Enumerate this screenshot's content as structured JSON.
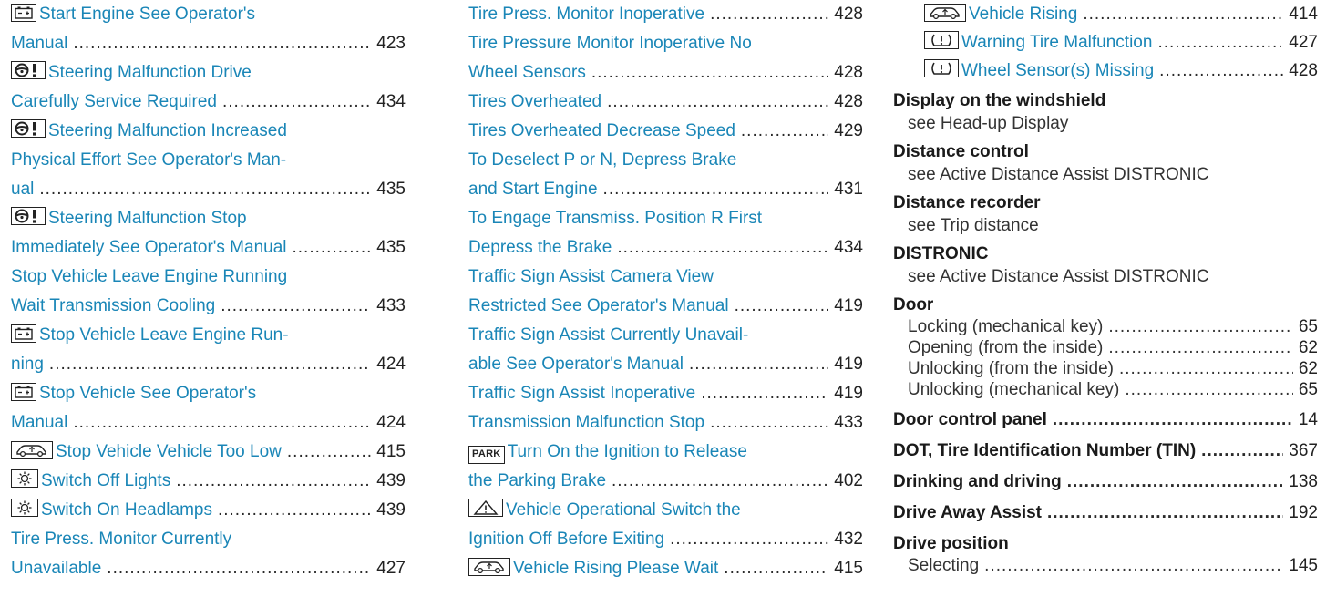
{
  "col1": [
    {
      "icon": "battery",
      "lines": [
        "Start Engine See Operator's",
        "Manual"
      ],
      "page": "423"
    },
    {
      "icon": "steering-warning",
      "lines": [
        "Steering Malfunction Drive",
        "Carefully Service Required"
      ],
      "page": "434"
    },
    {
      "icon": "steering-warning",
      "lines": [
        "Steering Malfunction Increased",
        "Physical Effort See Operator's Man-",
        "ual"
      ],
      "page": "435"
    },
    {
      "icon": "steering-warning",
      "lines": [
        "Steering Malfunction Stop",
        "Immediately See Operator's Manual"
      ],
      "page": "435"
    },
    {
      "icon": null,
      "lines": [
        "Stop Vehicle Leave Engine Running",
        "Wait Transmission Cooling"
      ],
      "page": "433"
    },
    {
      "icon": "battery",
      "lines": [
        "Stop Vehicle Leave Engine Run-",
        "ning"
      ],
      "page": "424"
    },
    {
      "icon": "battery",
      "lines": [
        "Stop Vehicle See Operator's",
        "Manual"
      ],
      "page": "424"
    },
    {
      "icon": "car-level",
      "lines": [
        "Stop Vehicle Vehicle Too Low"
      ],
      "page": "415"
    },
    {
      "icon": "light",
      "lines": [
        "Switch Off Lights"
      ],
      "page": "439"
    },
    {
      "icon": "light",
      "lines": [
        "Switch On Headlamps"
      ],
      "page": "439"
    },
    {
      "icon": null,
      "lines": [
        "Tire Press. Monitor Currently",
        "Unavailable"
      ],
      "page": "427"
    }
  ],
  "col2": [
    {
      "icon": null,
      "lines": [
        "Tire Press. Monitor Inoperative"
      ],
      "page": "428"
    },
    {
      "icon": null,
      "lines": [
        "Tire Pressure Monitor Inoperative No",
        "Wheel Sensors"
      ],
      "page": "428"
    },
    {
      "icon": null,
      "lines": [
        "Tires Overheated"
      ],
      "page": "428"
    },
    {
      "icon": null,
      "lines": [
        "Tires Overheated Decrease Speed"
      ],
      "page": "429"
    },
    {
      "icon": null,
      "lines": [
        "To Deselect P or N, Depress Brake",
        "and Start Engine"
      ],
      "page": "431"
    },
    {
      "icon": null,
      "lines": [
        "To Engage Transmiss. Position R First",
        "Depress the Brake"
      ],
      "page": "434"
    },
    {
      "icon": null,
      "lines": [
        "Traffic Sign Assist Camera View",
        "Restricted See Operator's Manual"
      ],
      "page": "419"
    },
    {
      "icon": null,
      "lines": [
        "Traffic Sign Assist Currently Unavail-",
        "able See Operator's Manual"
      ],
      "page": "419"
    },
    {
      "icon": null,
      "lines": [
        "Traffic Sign Assist Inoperative"
      ],
      "page": "419"
    },
    {
      "icon": null,
      "lines": [
        "Transmission Malfunction Stop"
      ],
      "page": "433"
    },
    {
      "icon": "park",
      "lines": [
        "Turn On the Ignition to Release",
        "the Parking Brake"
      ],
      "page": "402"
    },
    {
      "icon": "warning-triangle",
      "lines": [
        "Vehicle Operational Switch the",
        "Ignition Off Before Exiting"
      ],
      "page": "432"
    },
    {
      "icon": "car-level",
      "lines": [
        "Vehicle Rising Please Wait"
      ],
      "page": "415"
    }
  ],
  "col3_top": [
    {
      "icon": "car-level",
      "text": "Vehicle Rising",
      "page": "414"
    },
    {
      "icon": "tire-pressure",
      "text": "Warning Tire Malfunction",
      "page": "427"
    },
    {
      "icon": "tire-pressure",
      "text": "Wheel Sensor(s) Missing",
      "page": "428"
    }
  ],
  "park_label": "PARK",
  "headings": {
    "h1": "Display on the windshield",
    "h1_see": "see Head-up Display",
    "h2": "Distance control",
    "h2_see": "see Active Distance Assist DISTRONIC",
    "h3": "Distance recorder",
    "h3_see": "see Trip distance",
    "h4": "DISTRONIC",
    "h4_see": "see Active Distance Assist DISTRONIC",
    "h5": "Door",
    "door_items": [
      {
        "text": "Locking (mechanical key)",
        "page": "65"
      },
      {
        "text": "Opening (from the inside)",
        "page": "62"
      },
      {
        "text": "Unlocking (from the inside)",
        "page": "62"
      },
      {
        "text": "Unlocking (mechanical key)",
        "page": "65"
      }
    ],
    "h6": "Door control panel",
    "h6_page": "14",
    "h7": "DOT, Tire Identification Number (TIN)",
    "h7_page": "367",
    "h8": "Drinking and driving",
    "h8_page": "138",
    "h9": "Drive Away Assist",
    "h9_page": "192",
    "h10": "Drive position",
    "drive_items": [
      {
        "text": "Selecting",
        "page": "145"
      }
    ]
  }
}
